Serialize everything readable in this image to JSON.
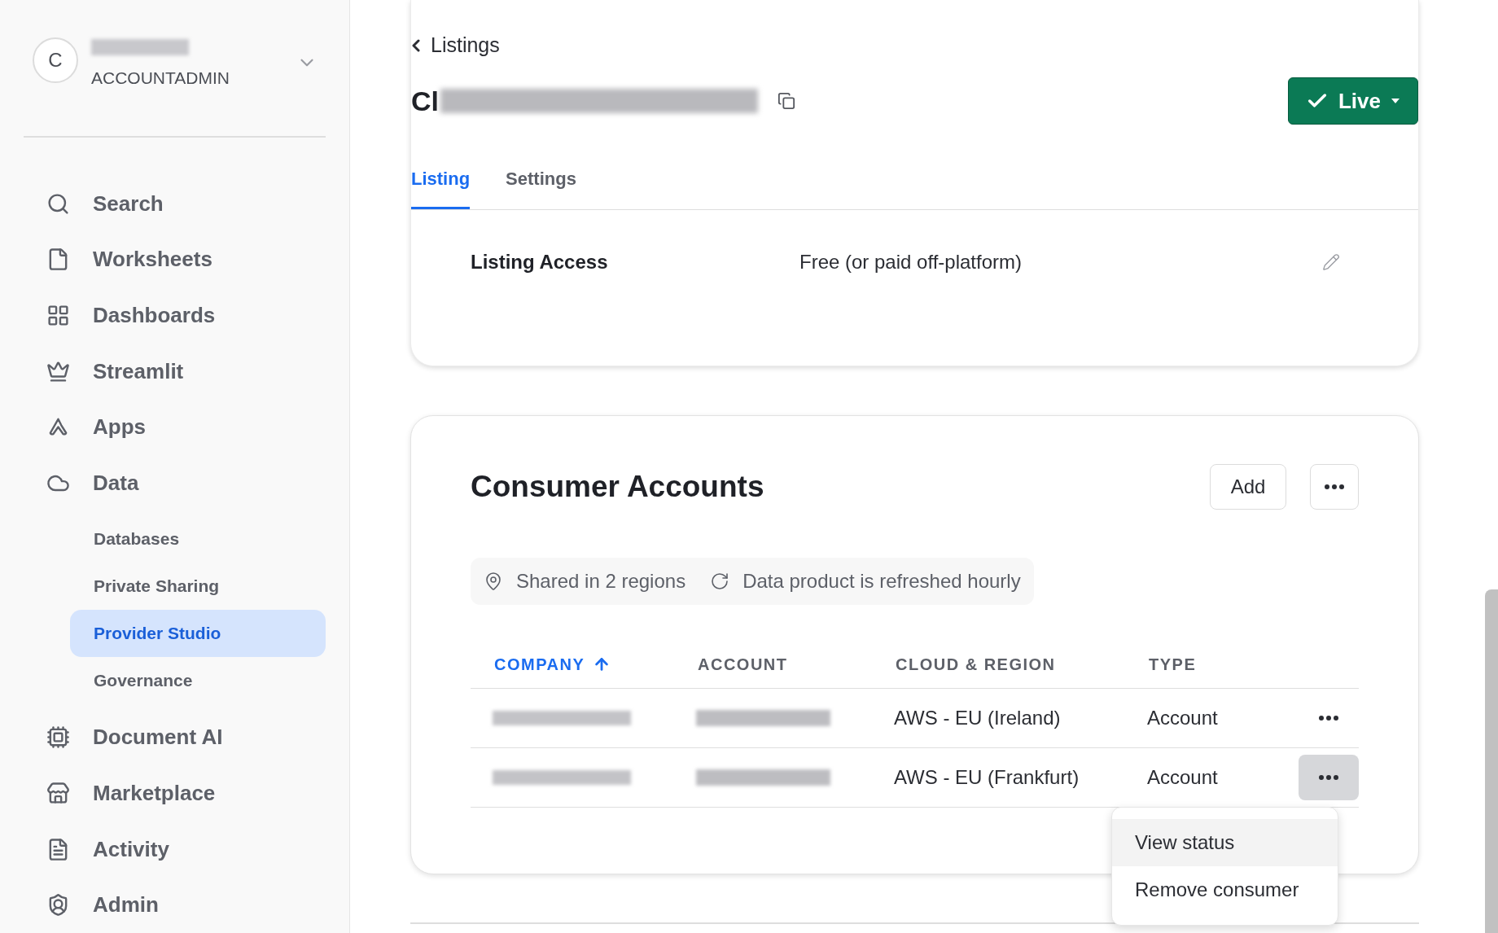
{
  "account": {
    "avatar": "C",
    "role": "ACCOUNTADMIN"
  },
  "sidebar": {
    "items": [
      {
        "label": "Search",
        "selected": false
      },
      {
        "label": "Worksheets",
        "selected": false
      },
      {
        "label": "Dashboards",
        "selected": false
      },
      {
        "label": "Streamlit",
        "selected": false
      },
      {
        "label": "Apps",
        "selected": false
      },
      {
        "label": "Data",
        "selected": false,
        "children": [
          {
            "label": "Databases",
            "selected": false
          },
          {
            "label": "Private Sharing",
            "selected": false
          },
          {
            "label": "Provider Studio",
            "selected": true
          },
          {
            "label": "Governance",
            "selected": false
          }
        ]
      },
      {
        "label": "Document AI",
        "selected": false
      },
      {
        "label": "Marketplace",
        "selected": false
      },
      {
        "label": "Activity",
        "selected": false
      },
      {
        "label": "Admin",
        "selected": false
      }
    ]
  },
  "breadcrumb": "Listings",
  "title": "Cl",
  "status_button": "Live",
  "tabs": [
    {
      "label": "Listing",
      "selected": true
    },
    {
      "label": "Settings",
      "selected": false
    }
  ],
  "listing_access": {
    "label": "Listing Access",
    "value": "Free (or paid off-platform)"
  },
  "consumer_accounts": {
    "title": "Consumer Accounts",
    "add_button": "Add",
    "info": [
      "Shared in 2 regions",
      "Data product is refreshed hourly"
    ],
    "table": {
      "columns": [
        {
          "label": "COMPANY",
          "sorted": true
        },
        {
          "label": "ACCOUNT",
          "sorted": false
        },
        {
          "label": "CLOUD & REGION",
          "sorted": false
        },
        {
          "label": "TYPE",
          "sorted": false
        }
      ],
      "rows": [
        {
          "cloud_region": "AWS - EU (Ireland)",
          "type": "Account",
          "menu_open": false
        },
        {
          "cloud_region": "AWS - EU (Frankfurt)",
          "type": "Account",
          "menu_open": true
        }
      ]
    },
    "menu": {
      "items": [
        {
          "label": "View status",
          "highlighted": true
        },
        {
          "label": "Remove consumer",
          "highlighted": false
        }
      ]
    }
  }
}
